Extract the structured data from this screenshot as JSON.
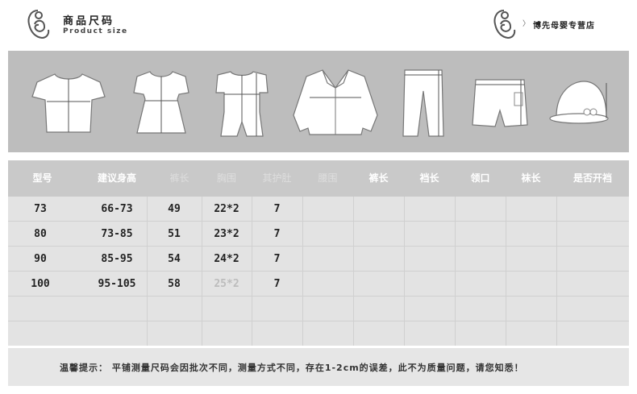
{
  "header": {
    "title": "商品尺码",
    "subtitle": "Product size",
    "store_arrow": "〉",
    "store_name": "博先母婴专营店"
  },
  "garments": [
    {
      "icon": "tshirt-icon"
    },
    {
      "icon": "dress-icon"
    },
    {
      "icon": "romper-icon"
    },
    {
      "icon": "jacket-icon"
    },
    {
      "icon": "pants-icon"
    },
    {
      "icon": "shorts-icon"
    },
    {
      "icon": "hat-icon"
    }
  ],
  "table": {
    "headers": [
      "型号",
      "建议身高",
      "裤长",
      "胸围",
      "其护肚",
      "腰围",
      "裤长",
      "裆长",
      "领口",
      "袜长",
      "是否开裆"
    ],
    "rows": [
      [
        "73",
        "66-73",
        "49",
        "22*2",
        "7",
        "",
        "",
        "",
        "",
        "",
        ""
      ],
      [
        "80",
        "73-85",
        "51",
        "23*2",
        "7",
        "",
        "",
        "",
        "",
        "",
        ""
      ],
      [
        "90",
        "85-95",
        "54",
        "24*2",
        "7",
        "",
        "",
        "",
        "",
        "",
        ""
      ],
      [
        "100",
        "95-105",
        "58",
        "25*2",
        "7",
        "",
        "",
        "",
        "",
        "",
        ""
      ],
      [
        "",
        "",
        "",
        "",
        "",
        "",
        "",
        "",
        "",
        "",
        ""
      ],
      [
        "",
        "",
        "",
        "",
        "",
        "",
        "",
        "",
        "",
        "",
        ""
      ]
    ]
  },
  "footer": {
    "note": "温馨提示： 平铺测量尺码会因批次不同，测量方式不同，存在1-2cm的误差，此不为质量问题，请您知悉！"
  }
}
